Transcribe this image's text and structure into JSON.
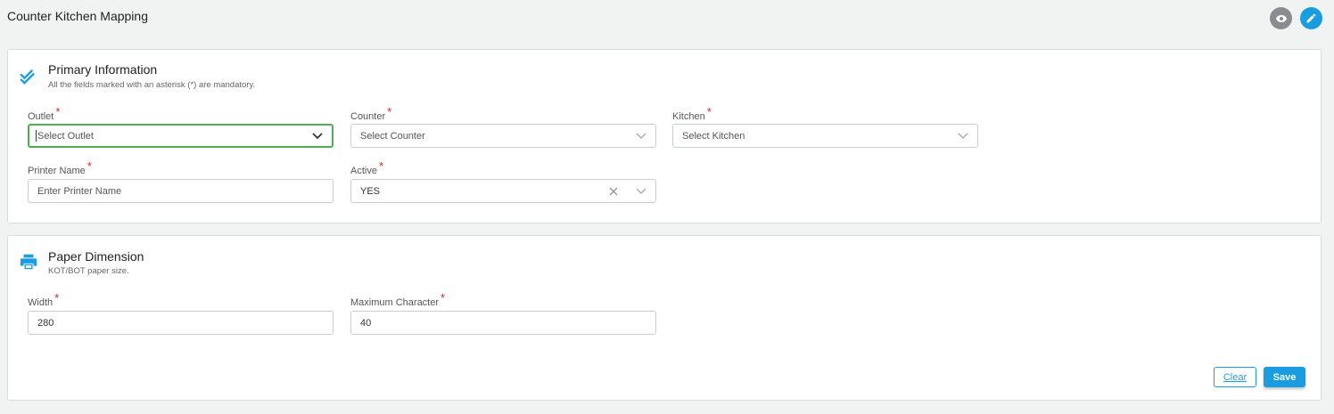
{
  "page": {
    "title": "Counter Kitchen Mapping"
  },
  "header_actions": {
    "view_icon": "eye-icon",
    "edit_icon": "pencil-icon"
  },
  "primary": {
    "title": "Primary Information",
    "subtitle": "All the fields marked with an asterisk (*) are mandatory.",
    "icon": "double-check-icon",
    "outlet": {
      "label": "Outlet",
      "placeholder": "Select Outlet",
      "required": "*"
    },
    "counter": {
      "label": "Counter",
      "placeholder": "Select Counter",
      "required": "*"
    },
    "kitchen": {
      "label": "Kitchen",
      "placeholder": "Select Kitchen",
      "required": "*"
    },
    "printer": {
      "label": "Printer Name",
      "placeholder": "Enter Printer Name",
      "required": "*"
    },
    "active": {
      "label": "Active",
      "value": "YES",
      "required": "*"
    }
  },
  "paper": {
    "title": "Paper Dimension",
    "subtitle": "KOT/BOT paper size.",
    "icon": "printer-icon",
    "width": {
      "label": "Width",
      "value": "280",
      "required": "*"
    },
    "max_char": {
      "label": "Maximum Character",
      "value": "40",
      "required": "*"
    }
  },
  "actions": {
    "clear": "Clear",
    "save": "Save"
  },
  "colors": {
    "accent": "#1a9de0",
    "focus": "#4caf50",
    "required": "#e02424"
  }
}
